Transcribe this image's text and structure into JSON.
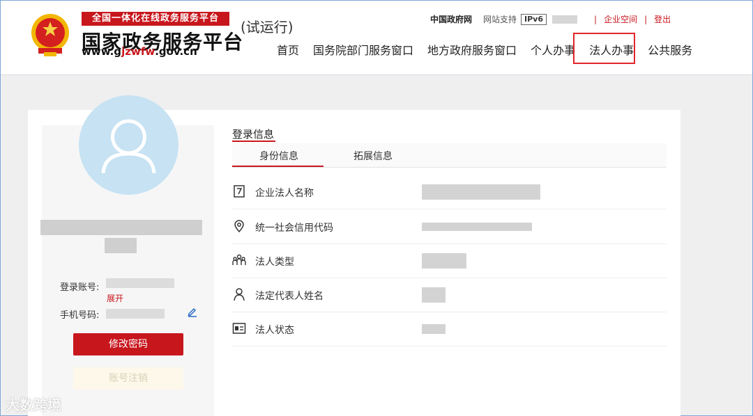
{
  "header": {
    "banner_text": "全国一体化在线政务服务平台",
    "title": "国家政务服务平台",
    "url_prefix": "www.g",
    "url_highlight": "jzwfw",
    "url_suffix": ".gov.cn",
    "trial": "(试运行)",
    "emblem_icon": "national-emblem-icon",
    "top_links": {
      "gov_net": "中国政府网",
      "site_support": "网站支持",
      "ipv6": "IPv6",
      "separator": "|",
      "enterprise_space": "企业空间",
      "logout": "登出"
    },
    "nav": [
      "首页",
      "国务院部门服务窗口",
      "地方政府服务窗口",
      "个人办事",
      "法人办事",
      "公共服务"
    ]
  },
  "sidebar": {
    "avatar_icon": "user-avatar-icon",
    "login_account_label": "登录账号:",
    "expand": "展开",
    "phone_label": "手机号码:",
    "edit_icon": "pencil-icon",
    "change_password": "修改密码",
    "cancel_account": "账号注销"
  },
  "main": {
    "section_title": "登录信息",
    "tabs": [
      "身份信息",
      "拓展信息"
    ],
    "rows": [
      {
        "icon": "document-icon",
        "label": "企业法人名称"
      },
      {
        "icon": "location-pin-icon",
        "label": "统一社会信用代码"
      },
      {
        "icon": "people-group-icon",
        "label": "法人类型"
      },
      {
        "icon": "person-icon",
        "label": "法定代表人姓名"
      },
      {
        "icon": "id-card-icon",
        "label": "法人状态"
      }
    ]
  },
  "watermark": "大数跨境",
  "colors": {
    "accent": "#c8161d",
    "avatar_bg": "#c6e2f3",
    "highlight_box": "#e0252b"
  }
}
